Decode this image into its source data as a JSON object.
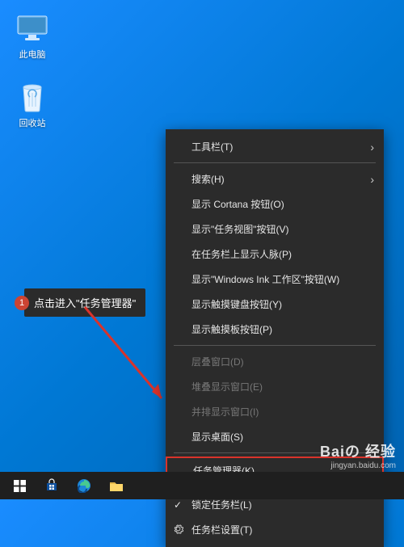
{
  "desktop": {
    "icons": {
      "this_pc": "此电脑",
      "recycle_bin": "回收站"
    }
  },
  "tooltip": {
    "badge": "1",
    "text": "点击进入\"任务管理器\""
  },
  "context_menu": {
    "toolbars": "工具栏(T)",
    "search": "搜索(H)",
    "show_cortana_button": "显示 Cortana 按钮(O)",
    "show_task_view_button": "显示\"任务视图\"按钮(V)",
    "show_people": "在任务栏上显示人脉(P)",
    "show_windows_ink": "显示\"Windows Ink 工作区\"按钮(W)",
    "show_touch_keyboard": "显示触摸键盘按钮(Y)",
    "show_touchpad": "显示触摸板按钮(P)",
    "cascade_windows": "层叠窗口(D)",
    "stacked_windows": "堆叠显示窗口(E)",
    "side_by_side": "并排显示窗口(I)",
    "show_desktop": "显示桌面(S)",
    "task_manager": "任务管理器(K)",
    "lock_taskbar": "锁定任务栏(L)",
    "taskbar_settings": "任务栏设置(T)"
  },
  "watermark": {
    "brand": "Baiの 经验",
    "sub": "jingyan.baidu.com"
  }
}
